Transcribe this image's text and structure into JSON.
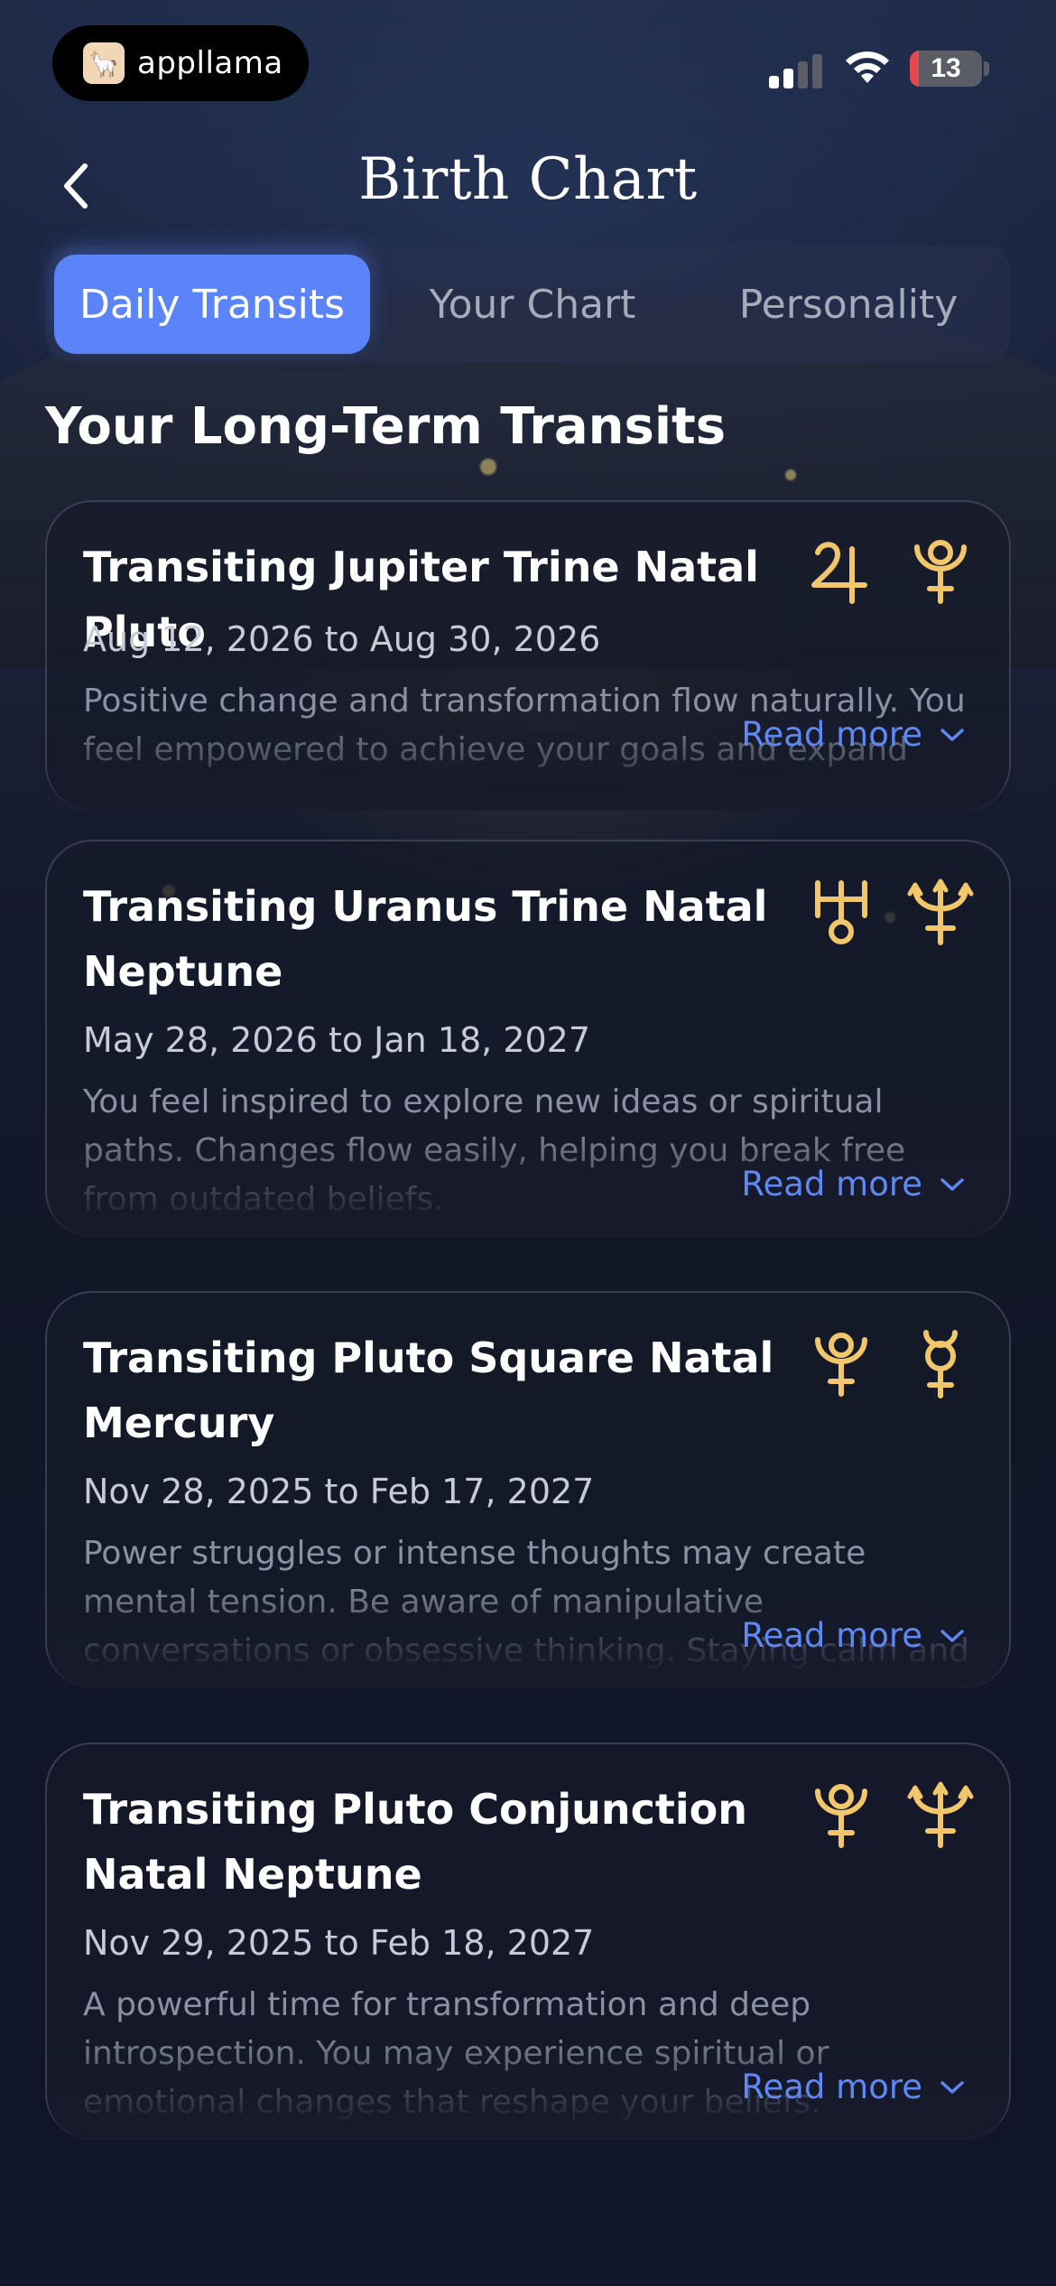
{
  "status_bar": {
    "app_pill_label": "appllama",
    "battery_level": "13",
    "battery_fraction": 0.13,
    "signal_bars_active": 2
  },
  "header": {
    "title": "Birth Chart"
  },
  "tabs": [
    {
      "label": "Daily Transits",
      "active": true
    },
    {
      "label": "Your Chart",
      "active": false
    },
    {
      "label": "Personality",
      "active": false
    }
  ],
  "section": {
    "title": "Your Long-Term Transits"
  },
  "cards": [
    {
      "title": "Transiting Jupiter Trine Natal Pluto",
      "dates": "Aug 12, 2026 to Aug 30, 2026",
      "description": "Positive change and transformation flow naturally. You feel empowered to achieve your goals and expand your horizons.",
      "read_more": "Read more",
      "icons": [
        "jupiter-icon",
        "pluto-icon"
      ]
    },
    {
      "title": "Transiting Uranus Trine Natal Neptune",
      "dates": "May 28, 2026 to Jan 18, 2027",
      "description": "You feel inspired to explore new ideas or spiritual paths. Changes flow easily, helping you break free from outdated beliefs.",
      "read_more": "Read more",
      "icons": [
        "uranus-icon",
        "neptune-icon"
      ]
    },
    {
      "title": "Transiting Pluto Square Natal Mercury",
      "dates": "Nov 28, 2025 to Feb 17, 2027",
      "description": "Power struggles or intense thoughts may create mental tension. Be aware of manipulative conversations or obsessive thinking. Staying calm and honest helps avoid c...",
      "read_more": "Read more",
      "icons": [
        "pluto-icon",
        "mercury-icon"
      ]
    },
    {
      "title": "Transiting Pluto Conjunction Natal Neptune",
      "dates": "Nov 29, 2025 to Feb 18, 2027",
      "description": "A powerful time for transformation and deep introspection. You may experience spiritual or emotional changes that reshape your beliefs.",
      "read_more": "Read more",
      "icons": [
        "pluto-icon",
        "neptune-icon"
      ]
    }
  ],
  "colors": {
    "accent": "#5a84f7",
    "glyph_gold": "#f2c76b",
    "background": "#151a2b",
    "battery_low": "#e5484d"
  }
}
